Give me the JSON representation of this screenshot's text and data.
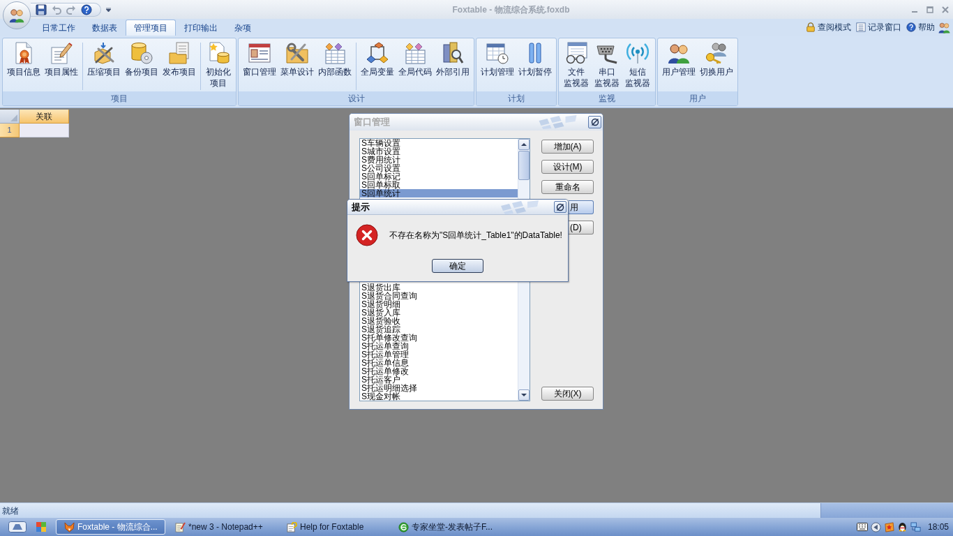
{
  "window": {
    "title": "Foxtable - 物流综合系统.foxdb"
  },
  "ribbon": {
    "tabs": [
      {
        "label": "日常工作",
        "selected": false
      },
      {
        "label": "数据表",
        "selected": false
      },
      {
        "label": "管理项目",
        "selected": true
      },
      {
        "label": "打印输出",
        "selected": false
      },
      {
        "label": "杂项",
        "selected": false
      }
    ],
    "quick_links": [
      {
        "label": "查阅模式"
      },
      {
        "label": "记录窗口"
      },
      {
        "label": "帮助"
      }
    ],
    "groups": [
      {
        "label": "项目",
        "sections": [
          [
            {
              "lines": [
                "项目信息"
              ]
            },
            {
              "lines": [
                "项目属性"
              ]
            }
          ],
          [
            {
              "lines": [
                "压缩项目"
              ]
            },
            {
              "lines": [
                "备份项目"
              ]
            },
            {
              "lines": [
                "发布项目"
              ]
            }
          ],
          [
            {
              "lines": [
                "初始化",
                "项目"
              ]
            }
          ]
        ]
      },
      {
        "label": "设计",
        "sections": [
          [
            {
              "lines": [
                "窗口管理"
              ]
            },
            {
              "lines": [
                "菜单设计"
              ]
            },
            {
              "lines": [
                "内部函数"
              ]
            }
          ],
          [
            {
              "lines": [
                "全局变量"
              ]
            },
            {
              "lines": [
                "全局代码"
              ]
            },
            {
              "lines": [
                "外部引用"
              ]
            }
          ]
        ]
      },
      {
        "label": "计划",
        "sections": [
          [
            {
              "lines": [
                "计划管理"
              ]
            },
            {
              "lines": [
                "计划暂停"
              ]
            }
          ]
        ]
      },
      {
        "label": "监视",
        "sections": [
          [
            {
              "lines": [
                "文件",
                "监视器"
              ]
            },
            {
              "lines": [
                "串口",
                "监视器"
              ]
            },
            {
              "lines": [
                "短信",
                "监视器"
              ]
            }
          ]
        ]
      },
      {
        "label": "用户",
        "sections": [
          [
            {
              "lines": [
                "用户管理"
              ]
            },
            {
              "lines": [
                "切换用户"
              ]
            }
          ]
        ]
      }
    ]
  },
  "sheet": {
    "columns": [
      "关联"
    ],
    "rows": [
      "1"
    ]
  },
  "window_manager": {
    "title": "窗口管理",
    "items_above": [
      {
        "label": "S车辆设置",
        "selected": false
      },
      {
        "label": "S城市设置",
        "selected": false
      },
      {
        "label": "S费用统计",
        "selected": false
      },
      {
        "label": "S公司设置",
        "selected": false
      },
      {
        "label": "S回单标记",
        "selected": false
      },
      {
        "label": "S回单标取",
        "selected": false
      },
      {
        "label": "S回单统计",
        "selected": true
      }
    ],
    "items_below": [
      {
        "label": "S退货出库",
        "selected": false
      },
      {
        "label": "S退货合同查询",
        "selected": false
      },
      {
        "label": "S退货明细",
        "selected": false
      },
      {
        "label": "S退货入库",
        "selected": false
      },
      {
        "label": "S退货验收",
        "selected": false
      },
      {
        "label": "S退货追踪",
        "selected": false
      },
      {
        "label": "S托单修改查询",
        "selected": false
      },
      {
        "label": "S托运单查询",
        "selected": false
      },
      {
        "label": "S托运单管理",
        "selected": false
      },
      {
        "label": "S托运单信息",
        "selected": false
      },
      {
        "label": "S托运单修改",
        "selected": false
      },
      {
        "label": "S托运客户",
        "selected": false
      },
      {
        "label": "S托运明细选择",
        "selected": false
      },
      {
        "label": "S现金对帐",
        "selected": false
      }
    ],
    "buttons": [
      {
        "label": "增加(A)",
        "kind": "full",
        "highlighted": false
      },
      {
        "label": "设计(M)",
        "kind": "full",
        "highlighted": false
      },
      {
        "label": "重命名",
        "kind": "full",
        "highlighted": false
      },
      {
        "label": "用",
        "kind": "partial",
        "highlighted": true
      },
      {
        "label": "(D)",
        "kind": "partial",
        "highlighted": false
      }
    ],
    "close_button": {
      "label": "关闭(X)"
    }
  },
  "alert": {
    "title": "提示",
    "message": "不存在名称为\"S回单统计_Table1\"的DataTable!",
    "button": {
      "label": "确定",
      "focused": true
    }
  },
  "status_bar": {
    "text": "就绪"
  },
  "taskbar": {
    "tasks": [
      {
        "label": "Foxtable - 物流综合...",
        "active": true
      },
      {
        "label": "*new 3 - Notepad++",
        "active": false
      },
      {
        "label": "Help for Foxtable",
        "active": false
      },
      {
        "label": "专家坐堂-发表帖子F...",
        "active": false
      }
    ],
    "clock": "18:05"
  }
}
